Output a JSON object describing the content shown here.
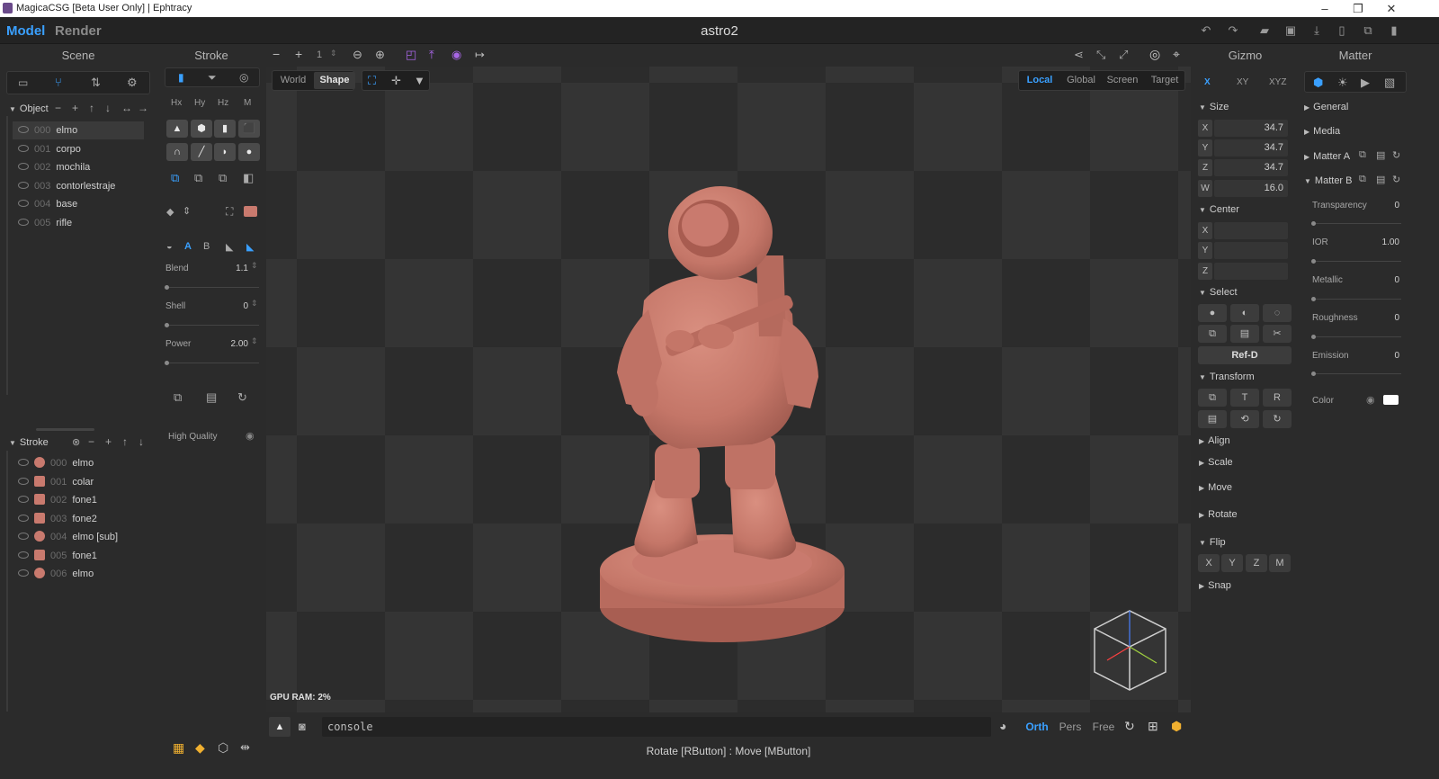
{
  "window": {
    "title": "MagicaCSG [Beta User Only] | Ephtracy",
    "min": "–",
    "restore": "❐",
    "close": "✕"
  },
  "menu": {
    "model": "Model",
    "render": "Render",
    "doc_title": "astro2"
  },
  "scene": {
    "header": "Scene",
    "object_section": "Object",
    "objects": [
      {
        "idx": "000",
        "name": "elmo"
      },
      {
        "idx": "001",
        "name": "corpo"
      },
      {
        "idx": "002",
        "name": "mochila"
      },
      {
        "idx": "003",
        "name": "contorlestraje"
      },
      {
        "idx": "004",
        "name": "base"
      },
      {
        "idx": "005",
        "name": "rifle"
      }
    ],
    "stroke_section": "Stroke",
    "strokes": [
      {
        "idx": "000",
        "name": "elmo",
        "shape": "round"
      },
      {
        "idx": "001",
        "name": "colar",
        "shape": "sq"
      },
      {
        "idx": "002",
        "name": "fone1",
        "shape": "sq"
      },
      {
        "idx": "003",
        "name": "fone2",
        "shape": "sq"
      },
      {
        "idx": "004",
        "name": "elmo [sub]",
        "shape": "round"
      },
      {
        "idx": "005",
        "name": "fone1",
        "shape": "sq"
      },
      {
        "idx": "006",
        "name": "elmo",
        "shape": "round"
      }
    ]
  },
  "stroke": {
    "header": "Stroke",
    "axes": [
      "Hx",
      "Hy",
      "Hz",
      "M"
    ],
    "mode_a": "A",
    "mode_b": "B",
    "blend_label": "Blend",
    "blend_value": "1.1",
    "blend_level": 0.0,
    "shell_label": "Shell",
    "shell_value": "0",
    "shell_level": 0.0,
    "power_label": "Power",
    "power_value": "2.00",
    "power_level": 0.0,
    "high_quality": "High Quality"
  },
  "viewport": {
    "step_value": "1",
    "space_world": "World",
    "space_shape": "Shape",
    "coord_local": "Local",
    "coord_global": "Global",
    "coord_screen": "Screen",
    "coord_target": "Target",
    "gpu_ram": "GPU RAM:  2%",
    "console": "console",
    "proj_orth": "Orth",
    "proj_pers": "Pers",
    "proj_free": "Free",
    "hint": "Rotate [RButton] : Move [MButton]"
  },
  "gizmo": {
    "header": "Gizmo",
    "tabs": [
      "X",
      "XY",
      "XYZ"
    ],
    "size_section": "Size",
    "size": {
      "X": "34.7",
      "Y": "34.7",
      "Z": "34.7",
      "W": "16.0"
    },
    "center_section": "Center",
    "center_axes": [
      "X",
      "Y",
      "Z"
    ],
    "select_section": "Select",
    "ref_d": "Ref-D",
    "transform_section": "Transform",
    "t_label": "T",
    "r_label": "R",
    "align": "Align",
    "scale": "Scale",
    "move": "Move",
    "rotate": "Rotate",
    "flip_section": "Flip",
    "flip": [
      "X",
      "Y",
      "Z",
      "M"
    ],
    "snap": "Snap"
  },
  "matter": {
    "header": "Matter",
    "general": "General",
    "media": "Media",
    "matter_a": "Matter A",
    "matter_b": "Matter B",
    "transparency_label": "Transparency",
    "transparency_value": "0",
    "ior_label": "IOR",
    "ior_value": "1.00",
    "metallic_label": "Metallic",
    "metallic_value": "0",
    "roughness_label": "Roughness",
    "roughness_value": "0",
    "emission_label": "Emission",
    "emission_value": "0",
    "color_label": "Color",
    "color_swatch": "#ffffff"
  },
  "colors": {
    "accent": "#3aa0ff",
    "shape": "#c97a6e",
    "purple": "#a866e6"
  }
}
